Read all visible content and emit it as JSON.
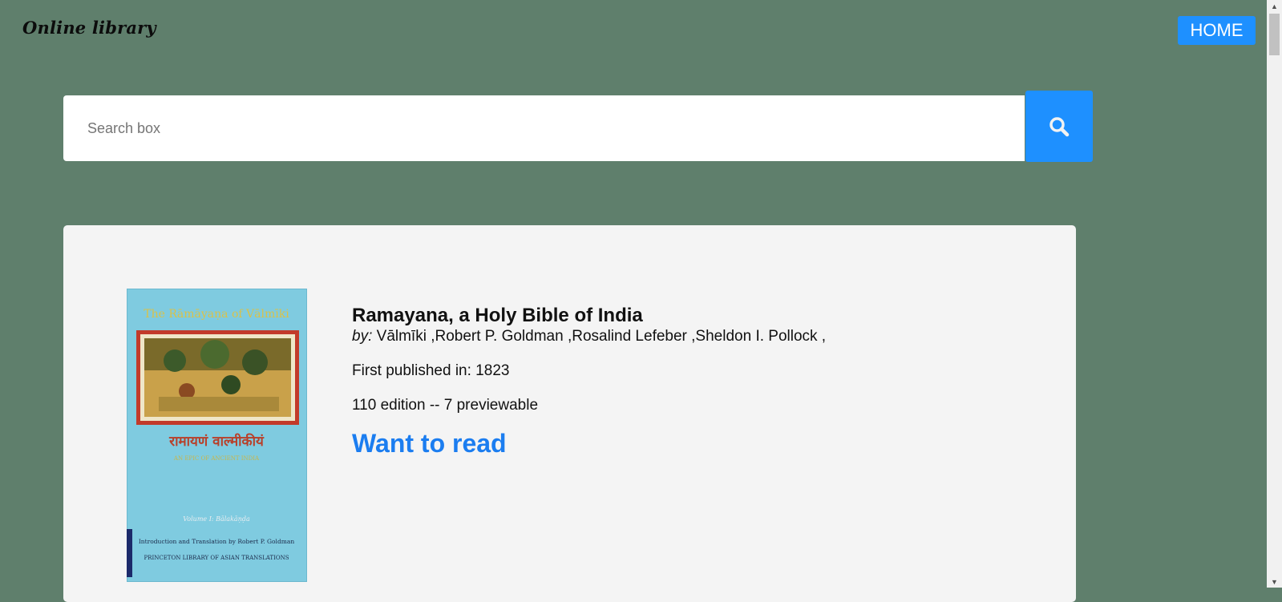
{
  "header": {
    "brand": "Online library",
    "home_label": "HOME"
  },
  "search": {
    "placeholder": "Search box",
    "value": ""
  },
  "book": {
    "title": "Ramayana, a Holy Bible of India",
    "by_label": "by:",
    "authors": "Vālmīki ,Robert P. Goldman ,Rosalind Lefeber ,Sheldon I. Pollock ,",
    "first_published": "First published in: 1823",
    "editions": "110 edition -- 7 previewable",
    "want_to_read": "Want to read",
    "cover": {
      "top_title": "The Rāmāyaṇa of Vālmīki",
      "devanagari": "रामायणं वाल्मीकीयं",
      "subtitle": "AN EPIC OF ANCIENT INDIA",
      "volume": "Volume I: Bālakāṇḍa",
      "intro": "Introduction and Translation by Robert P. Goldman",
      "series": "PRINCETON LIBRARY OF ASIAN TRANSLATIONS"
    }
  },
  "colors": {
    "background": "#5f7f6c",
    "accent": "#1e90ff",
    "link": "#1b7df0",
    "card": "#f4f4f4"
  },
  "icons": [
    "search-icon",
    "scroll-up-arrow-icon",
    "scroll-down-arrow-icon"
  ]
}
